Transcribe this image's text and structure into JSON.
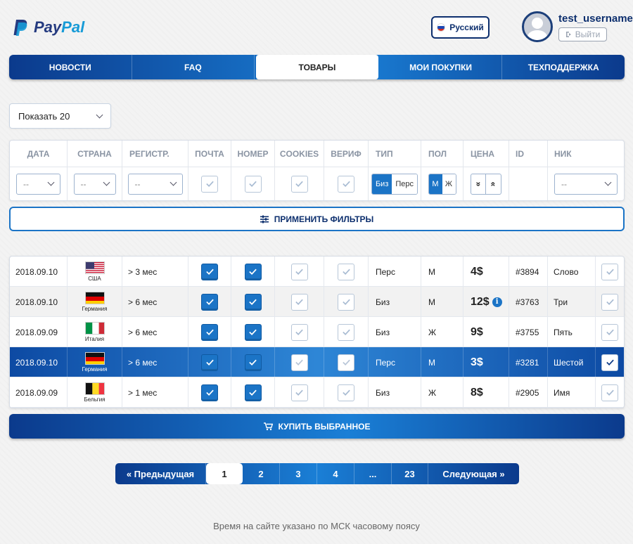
{
  "header": {
    "logo_pay": "Pay",
    "logo_pal": "Pal",
    "language": "Русский",
    "username": "test_username",
    "logout_label": "Выйти"
  },
  "nav": {
    "items": [
      "НОВОСТИ",
      "FAQ",
      "ТОВАРЫ",
      "МОИ ПОКУПКИ",
      "ТЕХПОДДЕРЖКА"
    ],
    "active": "ТОВАРЫ"
  },
  "show_select": {
    "value": "Показать 20"
  },
  "filters": {
    "headers": [
      "ДАТА",
      "СТРАНА",
      "РЕГИСТР.",
      "ПОЧТА",
      "НОМЕР",
      "COOKIES",
      "ВЕРИФ",
      "ТИП",
      "ПОЛ",
      "ЦЕНА",
      "ID",
      "НИК"
    ],
    "dropdown_placeholder": "-- ",
    "type_options": [
      "Биз",
      "Перс"
    ],
    "gender_options": [
      "М",
      "Ж"
    ],
    "price_sort": [
      "»",
      "«"
    ]
  },
  "apply_filters_label": "ПРИМЕНИТЬ ФИЛЬТРЫ",
  "rows": [
    {
      "date": "2018.09.10",
      "country": "США",
      "reg": "> 3 мес",
      "mail": true,
      "phone": true,
      "cookies": false,
      "verif": false,
      "type": "Перс",
      "gender": "М",
      "price": "4$",
      "info": false,
      "id": "#3894",
      "nick": "Слово",
      "selected": false
    },
    {
      "date": "2018.09.10",
      "country": "Германия",
      "reg": "> 6 мес",
      "mail": true,
      "phone": true,
      "cookies": false,
      "verif": false,
      "type": "Биз",
      "gender": "М",
      "price": "12$",
      "info": true,
      "id": "#3763",
      "nick": "Три",
      "selected": false
    },
    {
      "date": "2018.09.09",
      "country": "Италия",
      "reg": "> 6 мес",
      "mail": true,
      "phone": true,
      "cookies": false,
      "verif": false,
      "type": "Биз",
      "gender": "Ж",
      "price": "9$",
      "info": false,
      "id": "#3755",
      "nick": "Пять",
      "selected": false
    },
    {
      "date": "2018.09.10",
      "country": "Германия",
      "reg": "> 6 мес",
      "mail": true,
      "phone": true,
      "cookies": false,
      "verif": false,
      "type": "Перс",
      "gender": "М",
      "price": "3$",
      "info": false,
      "id": "#3281",
      "nick": "Шестой",
      "selected": true
    },
    {
      "date": "2018.09.09",
      "country": "Бельгия",
      "reg": "> 1 мес",
      "mail": true,
      "phone": true,
      "cookies": false,
      "verif": false,
      "type": "Биз",
      "gender": "Ж",
      "price": "8$",
      "info": false,
      "id": "#2905",
      "nick": "Имя",
      "selected": false
    }
  ],
  "buy_selected_label": "КУПИТЬ ВЫБРАННОЕ",
  "pagination": {
    "prev": "« Предыдущая",
    "pages": [
      "1",
      "2",
      "3",
      "4",
      "...",
      "23"
    ],
    "active": "1",
    "next": "Следующая »"
  },
  "footer_note": "Время на сайте указано по МСК часовому поясу",
  "colors": {
    "primary": "#1b74c6",
    "dark": "#0b3a8c"
  }
}
